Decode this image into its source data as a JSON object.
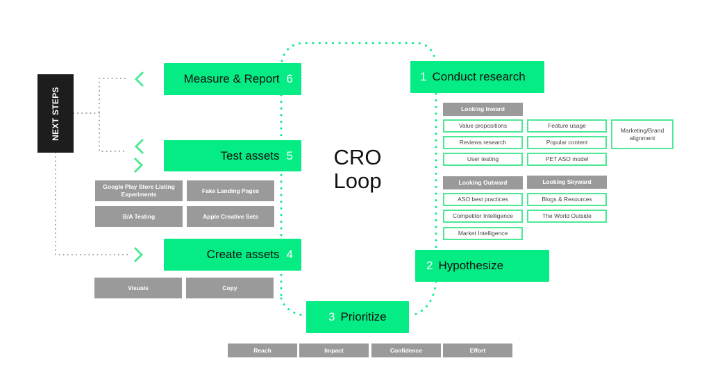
{
  "title": {
    "line1": "CRO",
    "line2": "Loop"
  },
  "colors": {
    "accent": "#05ec84",
    "gray_box": "#9a9a9a",
    "outline": "#4de896",
    "next_steps_bg": "#1d1d1d",
    "dotted_gray": "#999999"
  },
  "next_steps": {
    "label": "NEXT STEPS"
  },
  "steps": [
    {
      "number": "1",
      "label": "Conduct research"
    },
    {
      "number": "2",
      "label": "Hypothesize"
    },
    {
      "number": "3",
      "label": "Prioritize"
    },
    {
      "number": "4",
      "label": "Create assets"
    },
    {
      "number": "5",
      "label": "Test assets"
    },
    {
      "number": "6",
      "label": "Measure & Report"
    }
  ],
  "research": {
    "inward": {
      "header": "Looking Inward",
      "items": [
        "Value propositions",
        "Reviews research",
        "User testing"
      ]
    },
    "inward_col2": [
      "Feature usage",
      "Popular content",
      "PET ASO model"
    ],
    "brand": "Marketing/Brand alignment",
    "outward": {
      "header": "Looking Outward",
      "items": [
        "ASO best practices",
        "Competitor Intelligence",
        "Market Intelligence"
      ]
    },
    "skyward": {
      "header": "Looking Skyward",
      "items": [
        "Blogs & Resources",
        "The World Outside"
      ]
    }
  },
  "prioritize_items": [
    "Reach",
    "Impact",
    "Confidence",
    "Effort"
  ],
  "create_items": [
    "Visuals",
    "Copy"
  ],
  "test_items": [
    "Google Play Store Listing Experiments",
    "Fake Landing Pages",
    "B/A Testing",
    "Apple Creative Sets"
  ],
  "icons": {
    "chevron_left": "chevron-left-icon",
    "chevron_right": "chevron-right-icon"
  }
}
